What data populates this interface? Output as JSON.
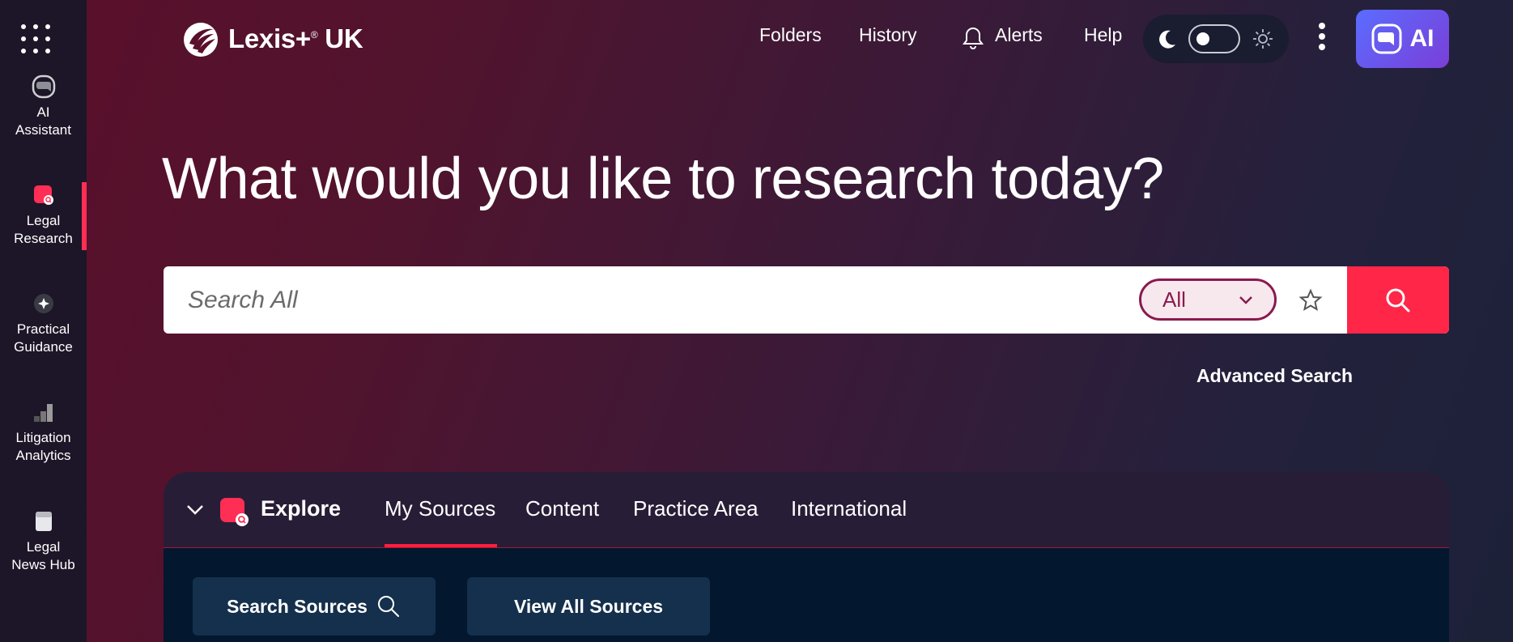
{
  "rail": {
    "items": [
      {
        "label": "AI\nAssistant",
        "icon": "ai-assistant-icon"
      },
      {
        "label": "Legal\nResearch",
        "icon": "legal-research-icon",
        "active": true
      },
      {
        "label": "Practical\nGuidance",
        "icon": "practical-guidance-icon"
      },
      {
        "label": "Litigation\nAnalytics",
        "icon": "litigation-analytics-icon"
      },
      {
        "label": "Legal\nNews Hub",
        "icon": "legal-news-hub-icon"
      }
    ]
  },
  "header": {
    "brand": "Lexis+",
    "brand_mark": "®",
    "region": "UK",
    "nav": {
      "folders": "Folders",
      "history": "History",
      "alerts": "Alerts",
      "help": "Help"
    },
    "ai_button": "AI"
  },
  "hero": {
    "title": "What would you like to research today?"
  },
  "search": {
    "placeholder": "Search All",
    "scope": "All",
    "advanced": "Advanced Search"
  },
  "explore": {
    "label": "Explore",
    "tabs": [
      "My Sources",
      "Content",
      "Practice Area",
      "International"
    ],
    "active_tab": "My Sources",
    "buttons": {
      "search_sources": "Search Sources",
      "view_all_sources": "View All Sources"
    }
  },
  "colors": {
    "accent": "#ff2648",
    "scope_border": "#8a1a4d",
    "ai_gradient_start": "#5b6cff",
    "ai_gradient_end": "#7a3fd8"
  }
}
